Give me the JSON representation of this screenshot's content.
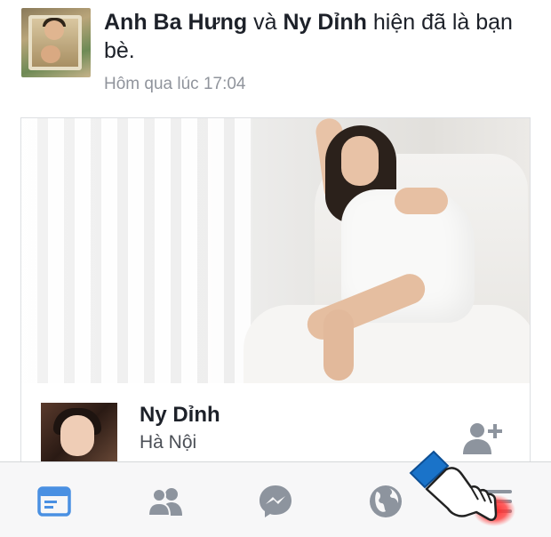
{
  "story": {
    "actor1": "Anh Ba Hưng",
    "connector": "và",
    "actor2": "Ny Dỉnh",
    "action": "hiện đã là bạn bè.",
    "timestamp": "Hôm qua lúc 17:04"
  },
  "profile": {
    "name": "Ny Dỉnh",
    "location": "Hà Nội"
  },
  "tabbar": {
    "items": [
      {
        "icon": "news-feed-icon",
        "active": true
      },
      {
        "icon": "friends-icon",
        "active": false
      },
      {
        "icon": "messenger-icon",
        "active": false
      },
      {
        "icon": "globe-icon",
        "active": false
      },
      {
        "icon": "menu-icon",
        "active": false
      }
    ]
  },
  "colors": {
    "accent": "#4a90e2",
    "inactive_icon": "#8d949e",
    "text_primary": "#1d2129",
    "text_secondary": "#90949c",
    "hand_cuff": "#1a73c9",
    "tap_highlight": "#ff2a2a"
  }
}
